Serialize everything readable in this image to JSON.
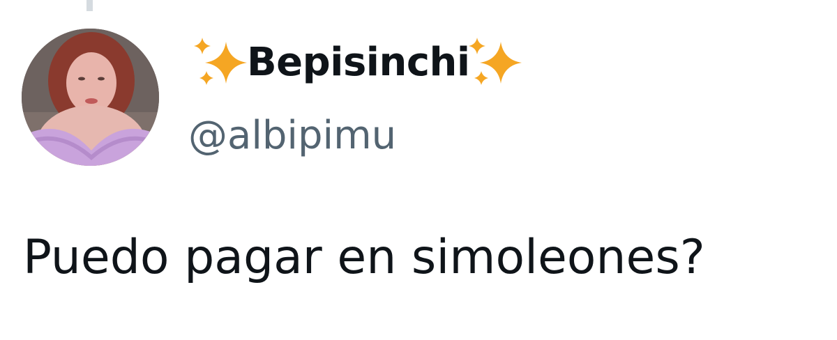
{
  "tweet": {
    "author": {
      "display_name": "Bepisinchi",
      "handle": "@albipimu",
      "name_decoration_icon": "sparkles-emoji-icon",
      "avatar_icon": "profile-photo"
    },
    "text": "Puedo pagar en simoleones?"
  },
  "colors": {
    "name": "#0f1419",
    "handle": "#536471",
    "text": "#0f1419",
    "sparkle": "#f5a623",
    "thread_line": "#d5dbe0"
  }
}
